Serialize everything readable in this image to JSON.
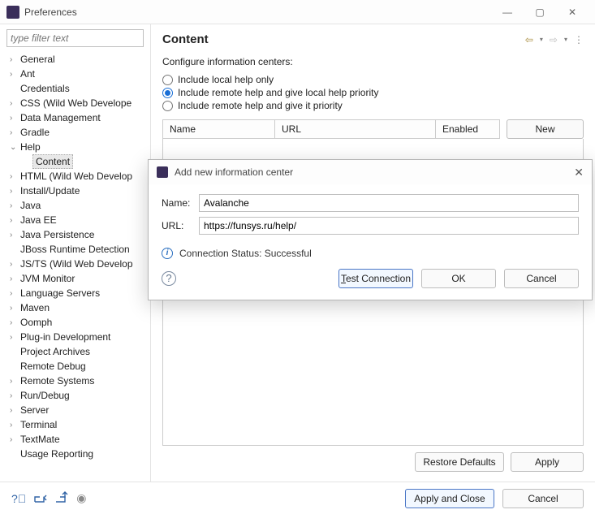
{
  "window": {
    "title": "Preferences"
  },
  "sidebar": {
    "filter_placeholder": "type filter text",
    "items": [
      {
        "label": "General",
        "expandable": true
      },
      {
        "label": "Ant",
        "expandable": true
      },
      {
        "label": "Credentials",
        "expandable": false
      },
      {
        "label": "CSS (Wild Web Develope",
        "expandable": true
      },
      {
        "label": "Data Management",
        "expandable": true
      },
      {
        "label": "Gradle",
        "expandable": true
      },
      {
        "label": "Help",
        "expandable": true,
        "expanded": true,
        "children": [
          {
            "label": "Content",
            "selected": true
          }
        ]
      },
      {
        "label": "HTML (Wild Web Develop",
        "expandable": true
      },
      {
        "label": "Install/Update",
        "expandable": true
      },
      {
        "label": "Java",
        "expandable": true
      },
      {
        "label": "Java EE",
        "expandable": true
      },
      {
        "label": "Java Persistence",
        "expandable": true
      },
      {
        "label": "JBoss Runtime Detection",
        "expandable": false
      },
      {
        "label": "JS/TS (Wild Web Develop",
        "expandable": true
      },
      {
        "label": "JVM Monitor",
        "expandable": true
      },
      {
        "label": "Language Servers",
        "expandable": true
      },
      {
        "label": "Maven",
        "expandable": true
      },
      {
        "label": "Oomph",
        "expandable": true
      },
      {
        "label": "Plug-in Development",
        "expandable": true
      },
      {
        "label": "Project Archives",
        "expandable": false
      },
      {
        "label": "Remote Debug",
        "expandable": false
      },
      {
        "label": "Remote Systems",
        "expandable": true
      },
      {
        "label": "Run/Debug",
        "expandable": true
      },
      {
        "label": "Server",
        "expandable": true
      },
      {
        "label": "Terminal",
        "expandable": true
      },
      {
        "label": "TextMate",
        "expandable": true
      },
      {
        "label": "Usage Reporting",
        "expandable": false
      }
    ]
  },
  "main": {
    "heading": "Content",
    "instruction": "Configure information centers:",
    "radios": [
      {
        "label": "Include local help only",
        "selected": false
      },
      {
        "label": "Include remote help and give local help priority",
        "selected": true
      },
      {
        "label": "Include remote help and give it priority",
        "selected": false
      }
    ],
    "columns": {
      "name": "Name",
      "url": "URL",
      "enabled": "Enabled"
    },
    "new_btn": "New",
    "restore_btn": "Restore Defaults",
    "apply_btn": "Apply"
  },
  "modal": {
    "title": "Add new information center",
    "name_label": "Name:",
    "name_value": "Avalanche",
    "url_label": "URL:",
    "url_value": "https://funsys.ru/help/",
    "status": "Connection Status: Successful",
    "test_btn": "Test Connection",
    "ok_btn": "OK",
    "cancel_btn": "Cancel"
  },
  "footer": {
    "apply_close": "Apply and Close",
    "cancel": "Cancel"
  }
}
